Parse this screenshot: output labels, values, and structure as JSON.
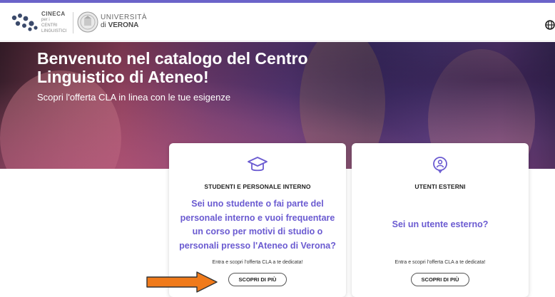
{
  "header": {
    "cineca": {
      "name": "CINECA",
      "sub1": "per i",
      "sub2": "CENTRI",
      "sub3": "LINGUISTICI"
    },
    "university": {
      "line1": "UNIVERSITÀ",
      "line2_prefix": "di ",
      "line2_bold": "VERONA"
    },
    "language_icon": "globe-icon"
  },
  "hero": {
    "title": "Benvenuto nel catalogo del Centro Linguistico di Ateneo!",
    "subtitle": "Scopri l'offerta CLA in linea con le tue esigenze"
  },
  "cards": [
    {
      "icon": "graduation-cap-icon",
      "heading": "STUDENTI E PERSONALE INTERNO",
      "question": "Sei uno studente o fai parte del personale interno e vuoi frequentare un corso per motivi di studio o personali presso l'Ateneo di Verona?",
      "hint": "Entra e scopri l'offerta CLA a te dedicata!",
      "button": "SCOPRI DI PIÙ"
    },
    {
      "icon": "user-location-icon",
      "heading": "UTENTI ESTERNI",
      "question": "Sei un utente esterno?",
      "hint": "Entra e scopri l'offerta CLA a te dedicata!",
      "button": "SCOPRI DI PIÙ"
    }
  ],
  "colors": {
    "accent": "#6b5bd1",
    "topbar": "#6b63c9",
    "annotation_arrow": "#f07a1a"
  }
}
